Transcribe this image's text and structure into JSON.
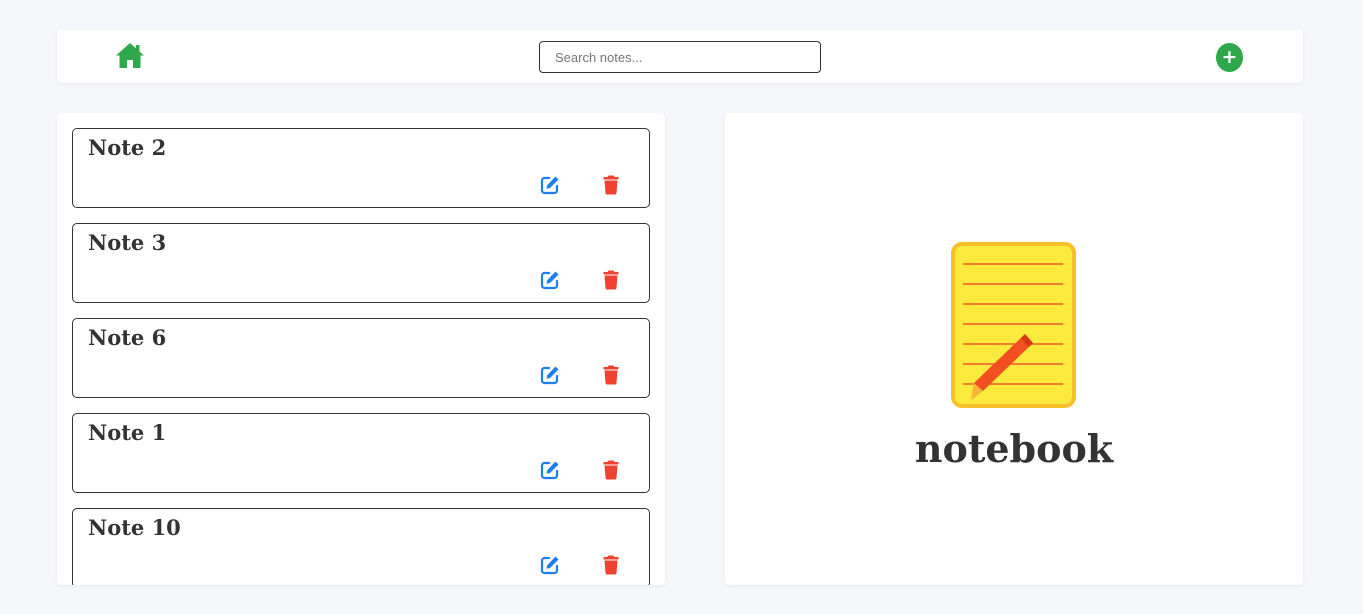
{
  "header": {
    "home_icon": "home-icon",
    "search_placeholder": "Search notes...",
    "search_value": "",
    "add_label": "+",
    "colors": {
      "home": "#2ea84a",
      "add": "#2ea84a"
    }
  },
  "notes": [
    {
      "title": "Note 2"
    },
    {
      "title": "Note 3"
    },
    {
      "title": "Note 6"
    },
    {
      "title": "Note 1"
    },
    {
      "title": "Note 10"
    }
  ],
  "note_actions": {
    "edit_icon": "edit-icon",
    "delete_icon": "trash-icon",
    "colors": {
      "edit": "#1e7ef0",
      "delete": "#f04230"
    }
  },
  "preview": {
    "logo_icon": "notebook-icon",
    "brand": "notebook"
  }
}
